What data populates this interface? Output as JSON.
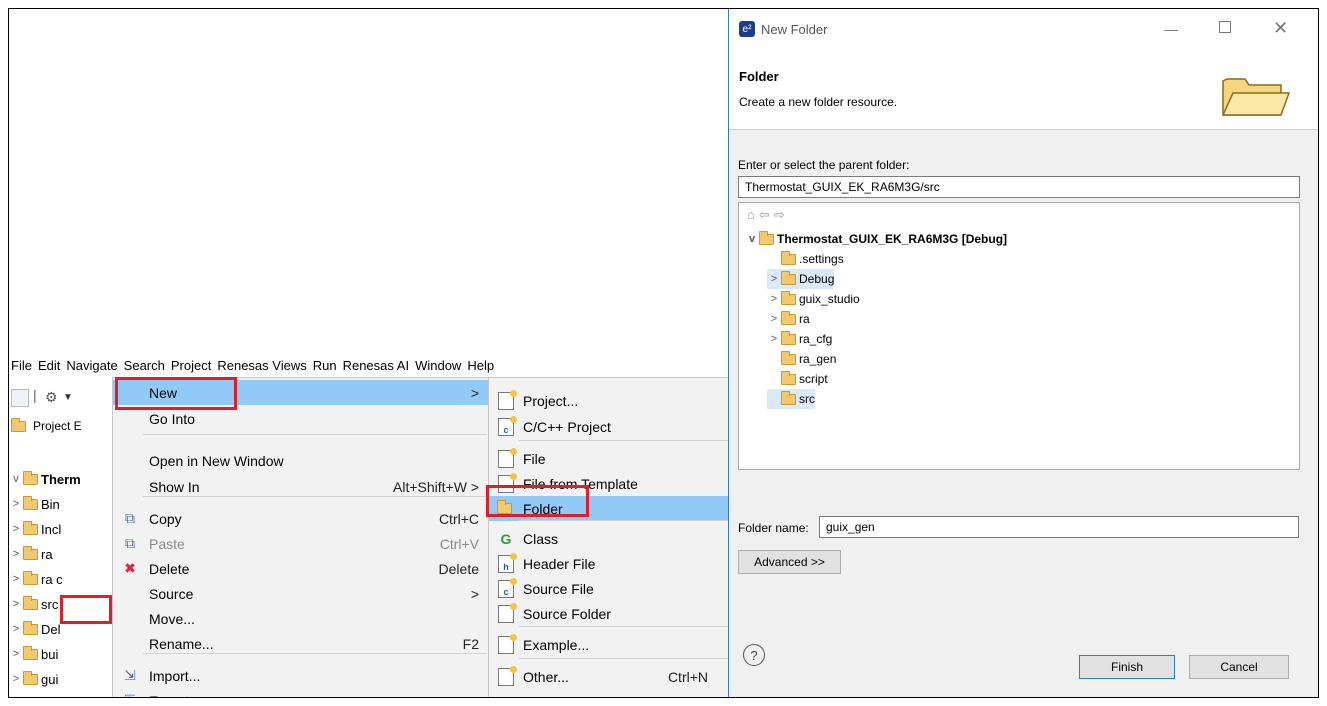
{
  "menubar": [
    "File",
    "Edit",
    "Navigate",
    "Search",
    "Project",
    "Renesas Views",
    "Run",
    "Renesas AI",
    "Window",
    "Help"
  ],
  "project_explorer": {
    "tab_label": "Project E",
    "tree": [
      {
        "label": "Therm",
        "chev": "v",
        "bold": true
      },
      {
        "label": "Bin",
        "chev": ">"
      },
      {
        "label": "Incl",
        "chev": ">"
      },
      {
        "label": "ra",
        "chev": ">"
      },
      {
        "label": "ra c",
        "chev": ">"
      },
      {
        "label": "src",
        "chev": ">"
      },
      {
        "label": "Del",
        "chev": ">"
      },
      {
        "label": "bui",
        "chev": ">"
      },
      {
        "label": "gui",
        "chev": ">"
      }
    ]
  },
  "context_menu": {
    "items": [
      {
        "label": "New",
        "accel": ">",
        "highlight": true
      },
      {
        "label": "Go Into",
        "accel": ""
      },
      {
        "label": "Open in New Window",
        "accel": ""
      },
      {
        "label": "Show In",
        "accel": "Alt+Shift+W >"
      },
      {
        "label": "Copy",
        "accel": "Ctrl+C",
        "icon": "copy-icon"
      },
      {
        "label": "Paste",
        "accel": "Ctrl+V",
        "icon": "paste-icon",
        "disabled": true
      },
      {
        "label": "Delete",
        "accel": "Delete",
        "icon": "delete-icon"
      },
      {
        "label": "Source",
        "accel": ">"
      },
      {
        "label": "Move...",
        "accel": ""
      },
      {
        "label": "Rename...",
        "accel": "F2"
      },
      {
        "label": "Import...",
        "accel": "",
        "icon": "import-icon"
      },
      {
        "label": "Export...",
        "accel": "",
        "icon": "export-icon"
      }
    ]
  },
  "submenu": {
    "items": [
      {
        "label": "Project...",
        "accel": ""
      },
      {
        "label": "C/C++ Project",
        "accel": ""
      },
      {
        "label": "File",
        "accel": ""
      },
      {
        "label": "File from Template",
        "accel": ""
      },
      {
        "label": "Folder",
        "accel": "",
        "highlight": true
      },
      {
        "label": "Class",
        "accel": ""
      },
      {
        "label": "Header File",
        "accel": ""
      },
      {
        "label": "Source File",
        "accel": ""
      },
      {
        "label": "Source Folder",
        "accel": ""
      },
      {
        "label": "Example...",
        "accel": ""
      },
      {
        "label": "Other...",
        "accel": "Ctrl+N"
      }
    ]
  },
  "dialog": {
    "window_title": "New Folder",
    "heading": "Folder",
    "description": "Create a new folder resource.",
    "parent_label": "Enter or select the parent folder:",
    "parent_value": "Thermostat_GUIX_EK_RA6M3G/src",
    "tree_root": "Thermostat_GUIX_EK_RA6M3G [Debug]",
    "tree_items": [
      {
        "label": ".settings",
        "chev": ""
      },
      {
        "label": "Debug",
        "chev": ">"
      },
      {
        "label": "guix_studio",
        "chev": ">"
      },
      {
        "label": "ra",
        "chev": ">"
      },
      {
        "label": "ra_cfg",
        "chev": ">"
      },
      {
        "label": "ra_gen",
        "chev": ""
      },
      {
        "label": "script",
        "chev": ""
      },
      {
        "label": "src",
        "chev": ""
      }
    ],
    "folder_name_label": "Folder name:",
    "folder_name_value": "guix_gen",
    "advanced_label": "Advanced >>",
    "finish_label": "Finish",
    "cancel_label": "Cancel",
    "help_glyph": "?"
  },
  "colors": {
    "highlight": "#91c9f7",
    "callout": "#e01e2a",
    "dialog_border": "#2b7cd3"
  }
}
